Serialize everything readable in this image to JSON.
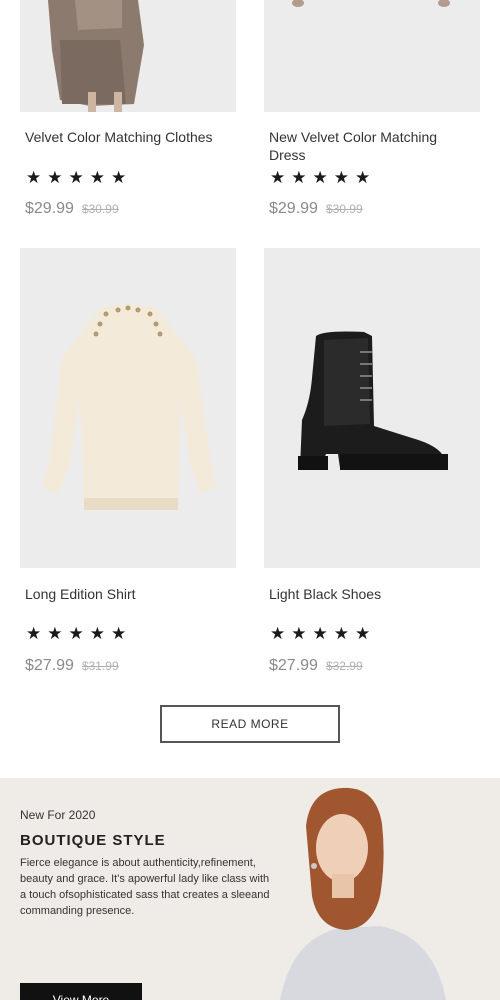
{
  "products": [
    {
      "name": "Velvet Color Matching Clothes",
      "stars": "★★★★★",
      "price": "$29.99",
      "old_price": "$30.99"
    },
    {
      "name": "New Velvet Color Matching Dress",
      "stars": "★★★★★",
      "price": "$29.99",
      "old_price": "$30.99"
    },
    {
      "name": "Long Edition Shirt",
      "stars": "★★★★★",
      "price": "$27.99",
      "old_price": "$31.99"
    },
    {
      "name": "Light Black Shoes",
      "stars": "★★★★★",
      "price": "$27.99",
      "old_price": "$32.99"
    }
  ],
  "read_more": "READ MORE",
  "banner": {
    "kicker": "New For 2020",
    "headline": "BOUTIQUE STYLE",
    "body": "Fierce elegance is about authenticity,refinement, beauty and grace. It's apowerful lady like class with a touch ofsophisticated sass that creates a sleeand commanding presence.",
    "cta": "View More"
  }
}
